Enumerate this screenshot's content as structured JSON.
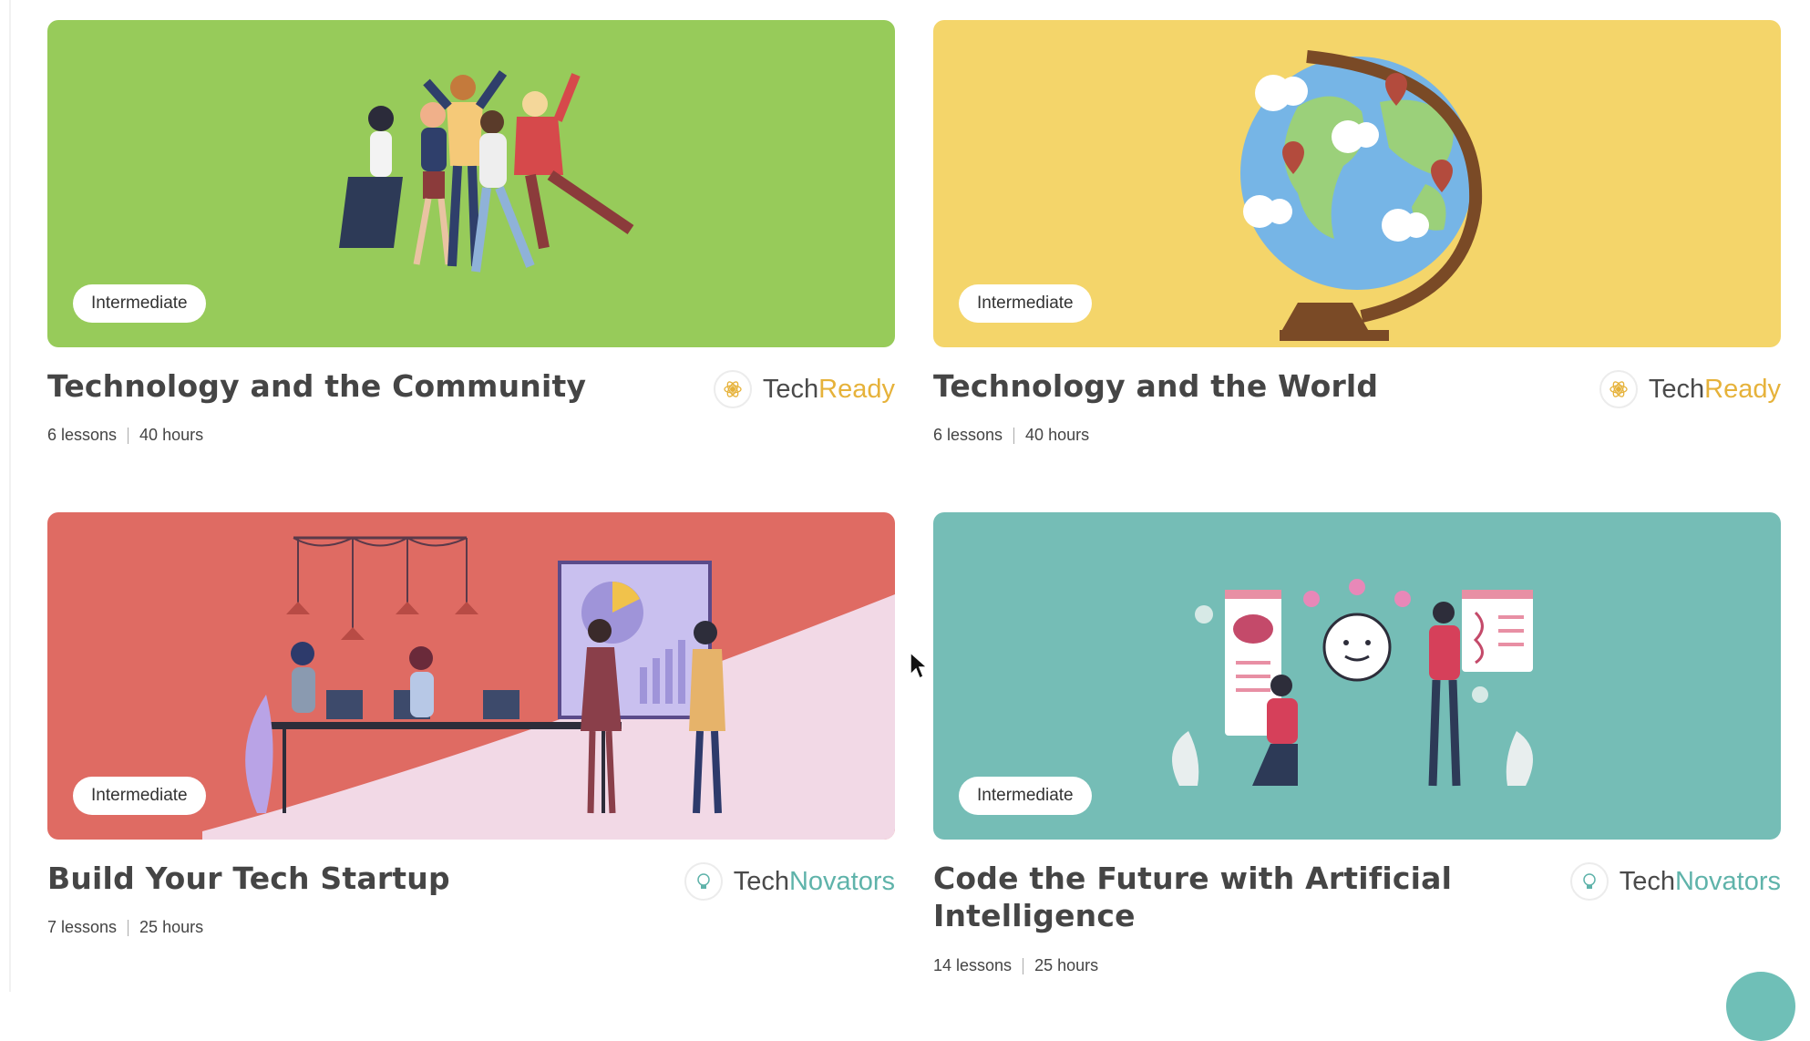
{
  "courses": [
    {
      "title": "Technology and the Community",
      "level": "Intermediate",
      "lessons": "6 lessons",
      "hours": "40 hours",
      "provider_a": "Tech",
      "provider_b": "Ready",
      "provider_color": "#e6b23a",
      "bg": "#97cb5a"
    },
    {
      "title": "Technology and the World",
      "level": "Intermediate",
      "lessons": "6 lessons",
      "hours": "40 hours",
      "provider_a": "Tech",
      "provider_b": "Ready",
      "provider_color": "#e6b23a",
      "bg": "#f4d56a"
    },
    {
      "title": "Build Your Tech Startup",
      "level": "Intermediate",
      "lessons": "7 lessons",
      "hours": "25 hours",
      "provider_a": "Tech",
      "provider_b": "Novators",
      "provider_color": "#5fb3aa",
      "bg": "#df6b63"
    },
    {
      "title": "Code the Future with Artificial Intelligence",
      "level": "Intermediate",
      "lessons": "14 lessons",
      "hours": "25 hours",
      "provider_a": "Tech",
      "provider_b": "Novators",
      "provider_color": "#5fb3aa",
      "bg": "#75bdb6"
    }
  ]
}
